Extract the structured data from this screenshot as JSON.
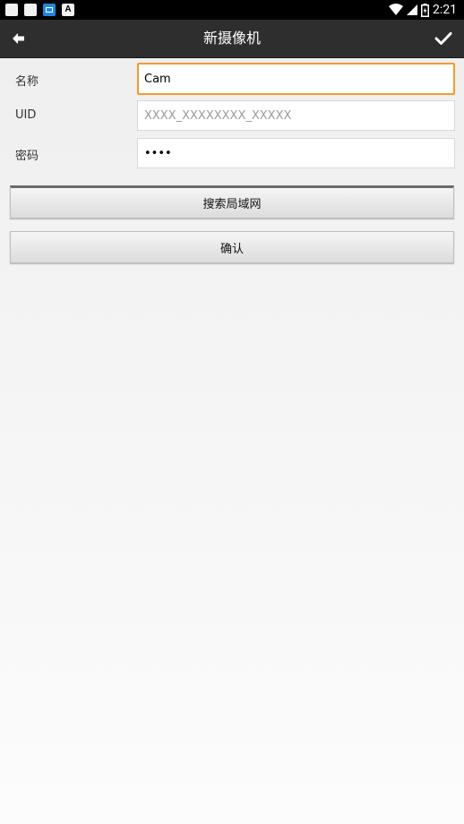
{
  "status_bar": {
    "time": "2:21",
    "icons": [
      "notification-square-icon",
      "notification-square-icon",
      "outlook-icon",
      "font-a-icon",
      "wifi-icon",
      "signal-icon",
      "battery-charging-icon"
    ]
  },
  "action_bar": {
    "title": "新摄像机",
    "back_icon": "arrow-left-icon",
    "confirm_icon": "checkmark-icon"
  },
  "form": {
    "name": {
      "label": "名称",
      "value": "Cam",
      "placeholder": ""
    },
    "uid": {
      "label": "UID",
      "value": "",
      "placeholder": "XXXX_XXXXXXXX_XXXXX"
    },
    "password": {
      "label": "密码",
      "value": "1234",
      "placeholder": ""
    }
  },
  "buttons": {
    "search_lan": "搜索局域网",
    "confirm": "确认"
  },
  "colors": {
    "focus_border": "#f59b2c",
    "action_bar": "#2e2e2e",
    "status_bar": "#000000"
  }
}
